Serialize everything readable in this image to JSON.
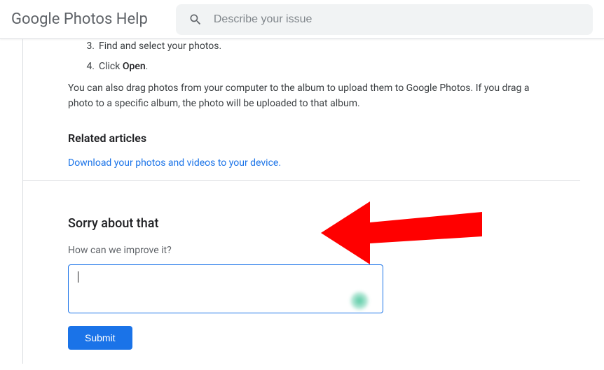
{
  "header": {
    "brand": "Google Photos Help",
    "search_placeholder": "Describe your issue"
  },
  "article": {
    "steps": [
      {
        "num": "3.",
        "text_before": "Find and select your photos."
      },
      {
        "num": "4.",
        "text_before": "Click ",
        "bold": "Open",
        "text_after": "."
      }
    ],
    "paragraph": "You can also drag photos from your computer to the album to upload them to Google Photos. If you drag a photo to a specific album, the photo will be uploaded to that album.",
    "related_heading": "Related articles",
    "related_link": "Download your photos and videos to your device."
  },
  "feedback": {
    "title": "Sorry about that",
    "label": "How can we improve it?",
    "submit": "Submit"
  }
}
